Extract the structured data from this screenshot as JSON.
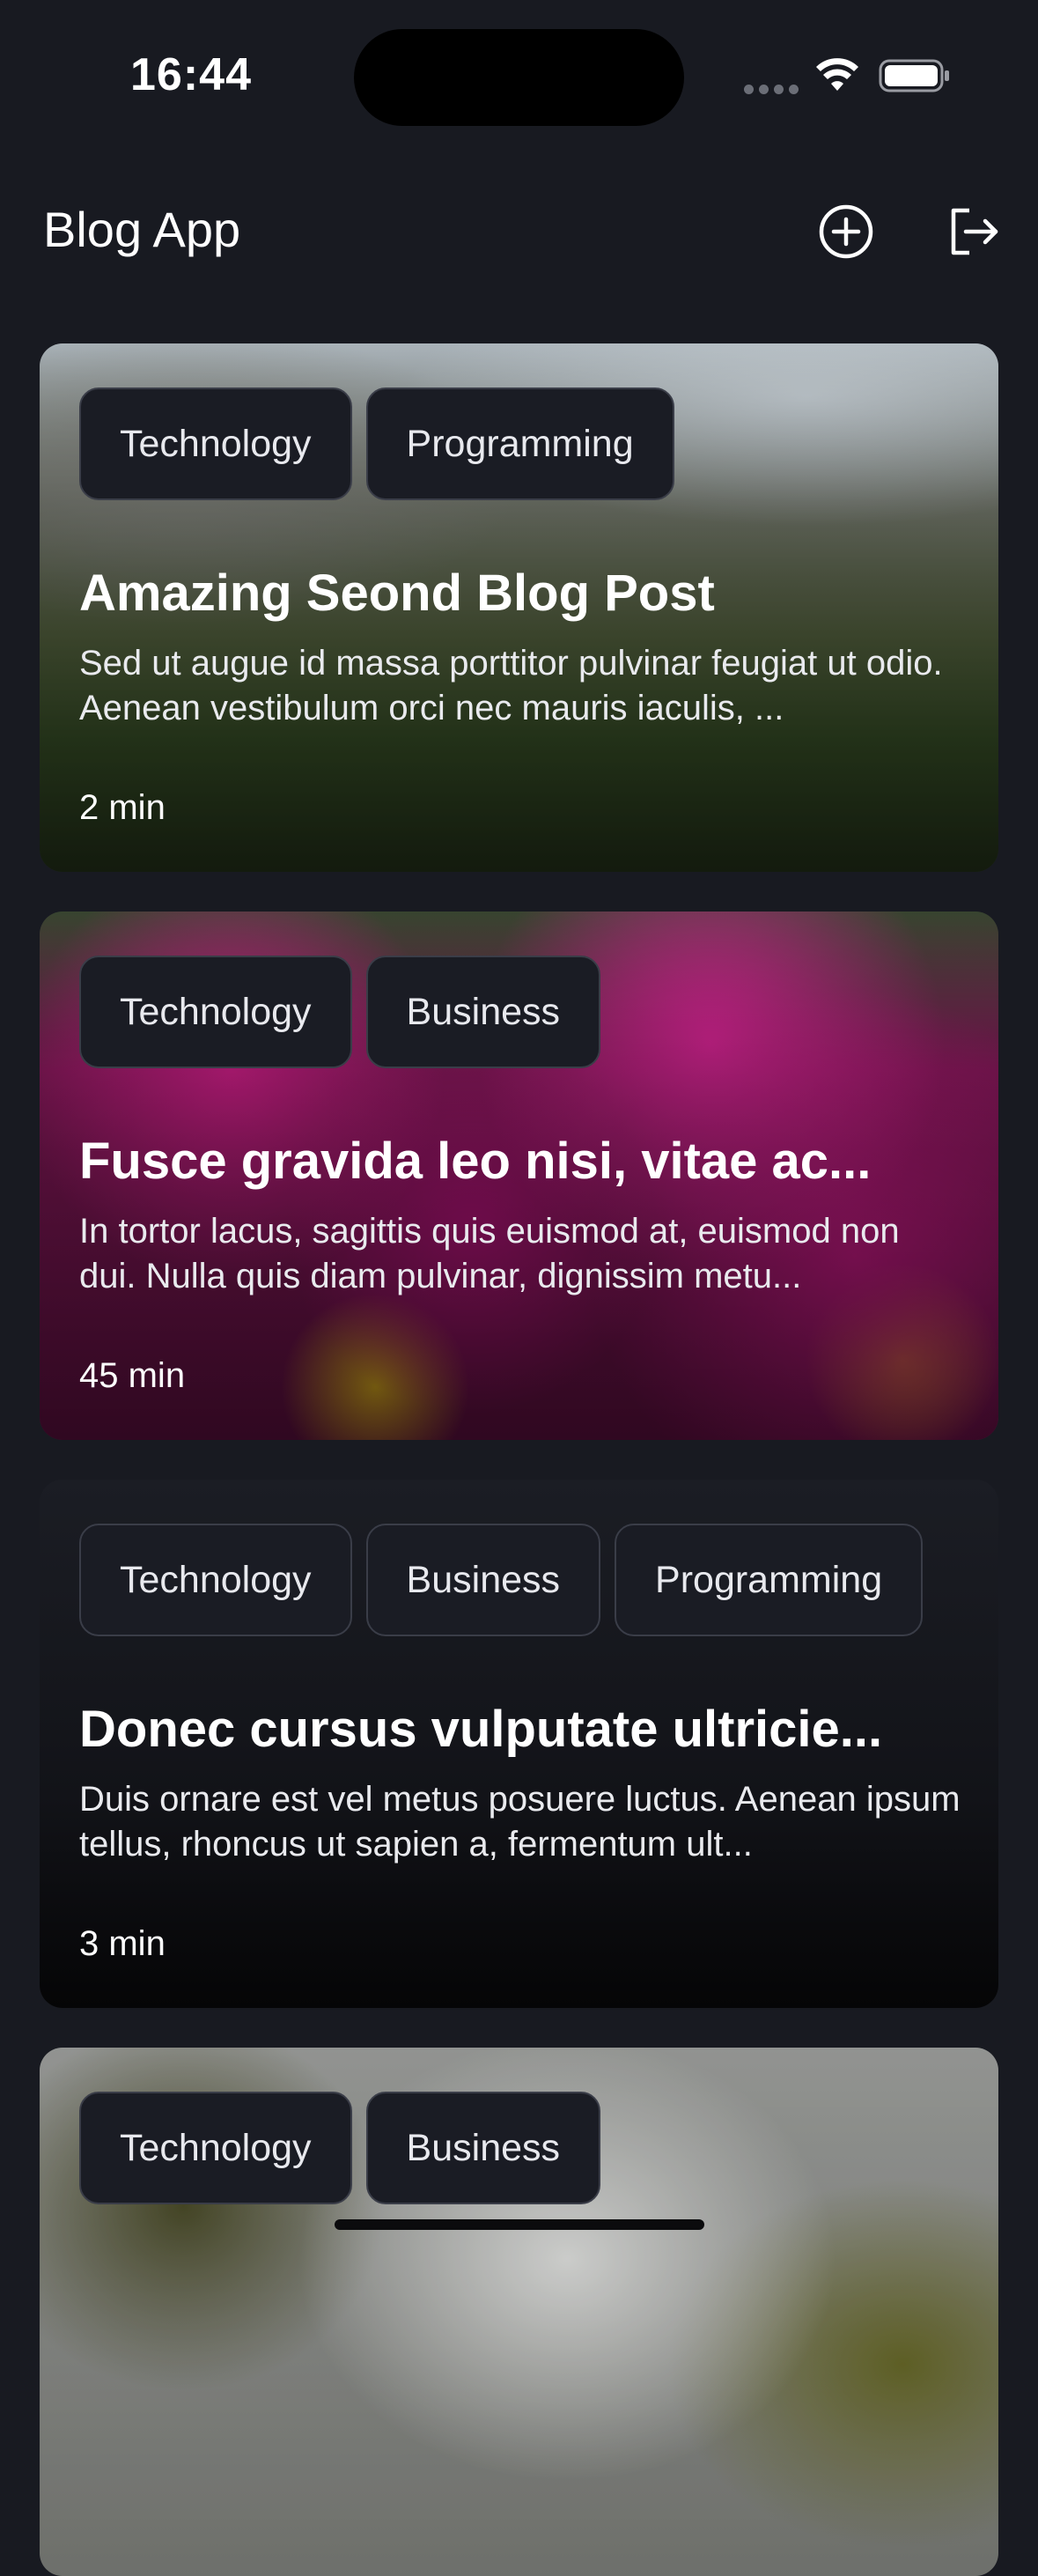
{
  "status_bar": {
    "time": "16:44"
  },
  "header": {
    "title": "Blog App",
    "add_icon": "add-circle-icon",
    "logout_icon": "logout-icon"
  },
  "posts": [
    {
      "tags": [
        "Technology",
        "Programming"
      ],
      "title": "Amazing Seond Blog Post",
      "excerpt": "Sed ut augue id massa porttitor pulvinar feugiat ut odio. Aenean vestibulum orci nec mauris iaculis, ...",
      "read_time": "2 min"
    },
    {
      "tags": [
        "Technology",
        "Business"
      ],
      "title": "Fusce gravida leo nisi, vitae ac...",
      "excerpt": "In tortor lacus, sagittis quis euismod at, euismod non dui. Nulla quis diam pulvinar, dignissim metu...",
      "read_time": "45 min"
    },
    {
      "tags": [
        "Technology",
        "Business",
        "Programming"
      ],
      "title": "Donec cursus vulputate ultricie...",
      "excerpt": "Duis ornare est vel metus posuere luctus. Aenean ipsum tellus, rhoncus ut sapien a, fermentum ult...",
      "read_time": "3 min"
    },
    {
      "tags": [
        "Technology",
        "Business"
      ]
    }
  ]
}
